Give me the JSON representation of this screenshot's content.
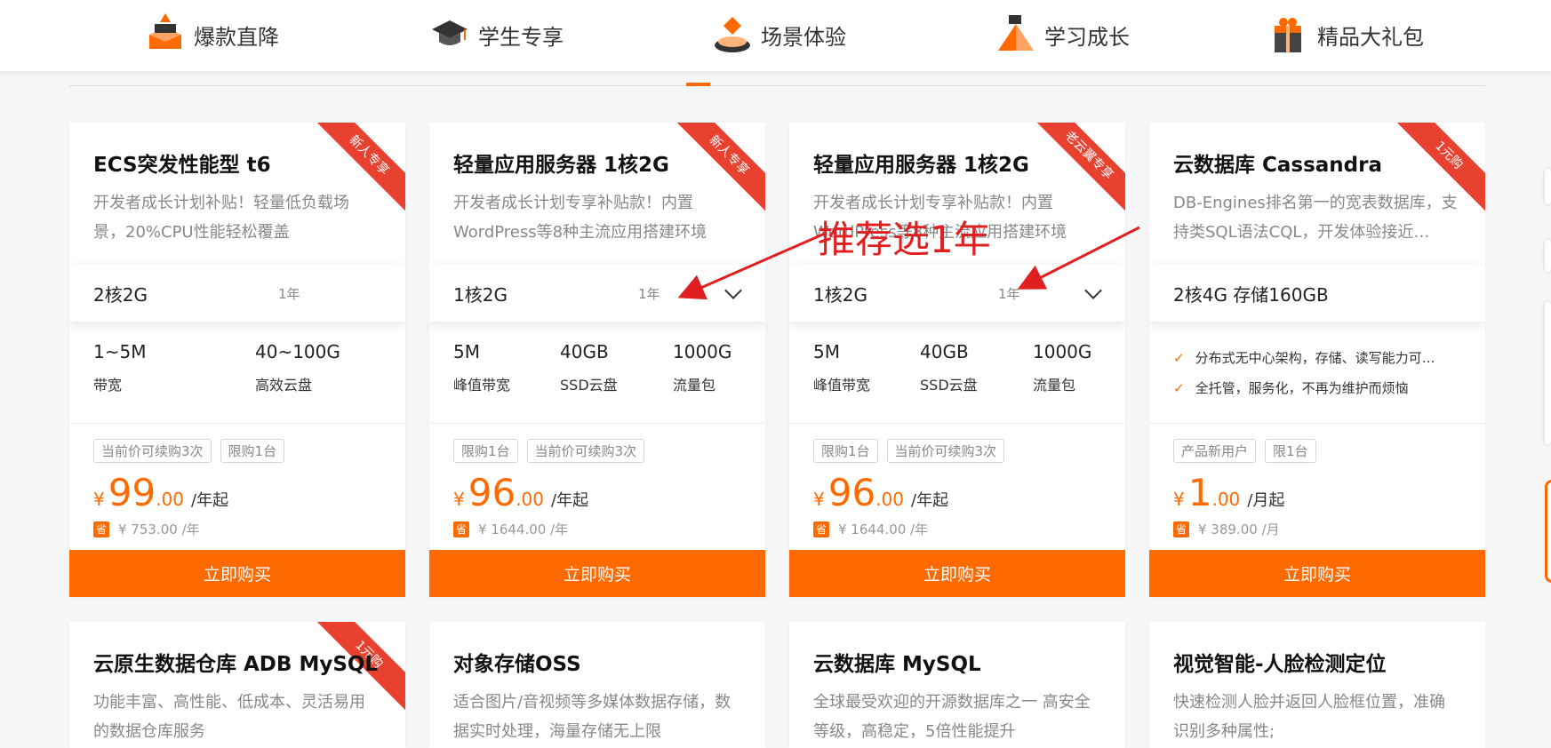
{
  "tabs": [
    {
      "label": "爆款直降",
      "icon": "fire-stack-icon"
    },
    {
      "label": "学生专享",
      "icon": "graduation-cap-icon"
    },
    {
      "label": "场景体验",
      "icon": "scene-box-icon"
    },
    {
      "label": "学习成长",
      "icon": "growth-pyramid-icon"
    },
    {
      "label": "精品大礼包",
      "icon": "gift-box-icon"
    }
  ],
  "cards": [
    {
      "title": "ECS突发性能型 t6",
      "desc": "开发者成长计划补贴！轻量低负载场景，20%CPU性能轻松覆盖",
      "ribbon": "新人专享",
      "spec": "2核2G",
      "period": "1年",
      "metrics": [
        {
          "v": "1~5M",
          "l": "带宽"
        },
        {
          "v": "40~100G",
          "l": "高效云盘"
        }
      ],
      "tags": [
        "当前价可续购3次",
        "限购1台"
      ],
      "price_int": "99",
      "price_dec": ".00",
      "price_unit": "/年起",
      "currency": "¥",
      "original": "¥ 753.00 /年",
      "buy": "立即购买"
    },
    {
      "title": "轻量应用服务器 1核2G",
      "desc": "开发者成长计划专享补贴款！内置WordPress等8种主流应用搭建环境",
      "ribbon": "新人专享",
      "spec": "1核2G",
      "period": "1年",
      "metrics": [
        {
          "v": "5M",
          "l": "峰值带宽"
        },
        {
          "v": "40GB",
          "l": "SSD云盘"
        },
        {
          "v": "1000G",
          "l": "流量包"
        }
      ],
      "tags": [
        "限购1台",
        "当前价可续购3次"
      ],
      "price_int": "96",
      "price_dec": ".00",
      "price_unit": "/年起",
      "currency": "¥",
      "original": "¥ 1644.00 /年",
      "buy": "立即购买"
    },
    {
      "title": "轻量应用服务器 1核2G",
      "desc": "开发者成长计划专享补贴款！内置WordPress等8种主流应用搭建环境",
      "ribbon": "老云翼专享",
      "spec": "1核2G",
      "period": "1年",
      "metrics": [
        {
          "v": "5M",
          "l": "峰值带宽"
        },
        {
          "v": "40GB",
          "l": "SSD云盘"
        },
        {
          "v": "1000G",
          "l": "流量包"
        }
      ],
      "tags": [
        "限购1台",
        "当前价可续购3次"
      ],
      "price_int": "96",
      "price_dec": ".00",
      "price_unit": "/年起",
      "currency": "¥",
      "original": "¥ 1644.00 /年",
      "buy": "立即购买"
    },
    {
      "title": "云数据库 Cassandra",
      "desc": "DB-Engines排名第一的宽表数据库，支持类SQL语法CQL，开发体验接近…",
      "ribbon": "1元购",
      "spec": "2核4G 存储160GB",
      "period": "",
      "features": [
        "分布式无中心架构，存储、读写能力可…",
        "全托管，服务化，不再为维护而烦恼"
      ],
      "tags": [
        "产品新用户",
        "限1台"
      ],
      "price_int": "1",
      "price_dec": ".00",
      "price_unit": "/月起",
      "currency": "¥",
      "original": "¥ 389.00 /月",
      "buy": "立即购买"
    }
  ],
  "cards_row2": [
    {
      "title": "云原生数据仓库 ADB MySQL",
      "desc": "功能丰富、高性能、低成本、灵活易用的数据仓库服务",
      "ribbon": "1元购"
    },
    {
      "title": "对象存储OSS",
      "desc": "适合图片/音视频等多媒体数据存储，数据实时处理，海量存储无上限"
    },
    {
      "title": "云数据库 MySQL",
      "desc": "全球最受欢迎的开源数据库之一 高安全等级，高稳定，5倍性能提升"
    },
    {
      "title": "视觉智能-人脸检测定位",
      "desc": "快速检测人脸并返回人脸框位置，准确识别多种属性;"
    }
  ],
  "annotation": "推荐选1年",
  "save_badge": "省",
  "colors": {
    "accent": "#ff6a00",
    "ribbon": "#e8412f",
    "annotation": "#e02020"
  }
}
